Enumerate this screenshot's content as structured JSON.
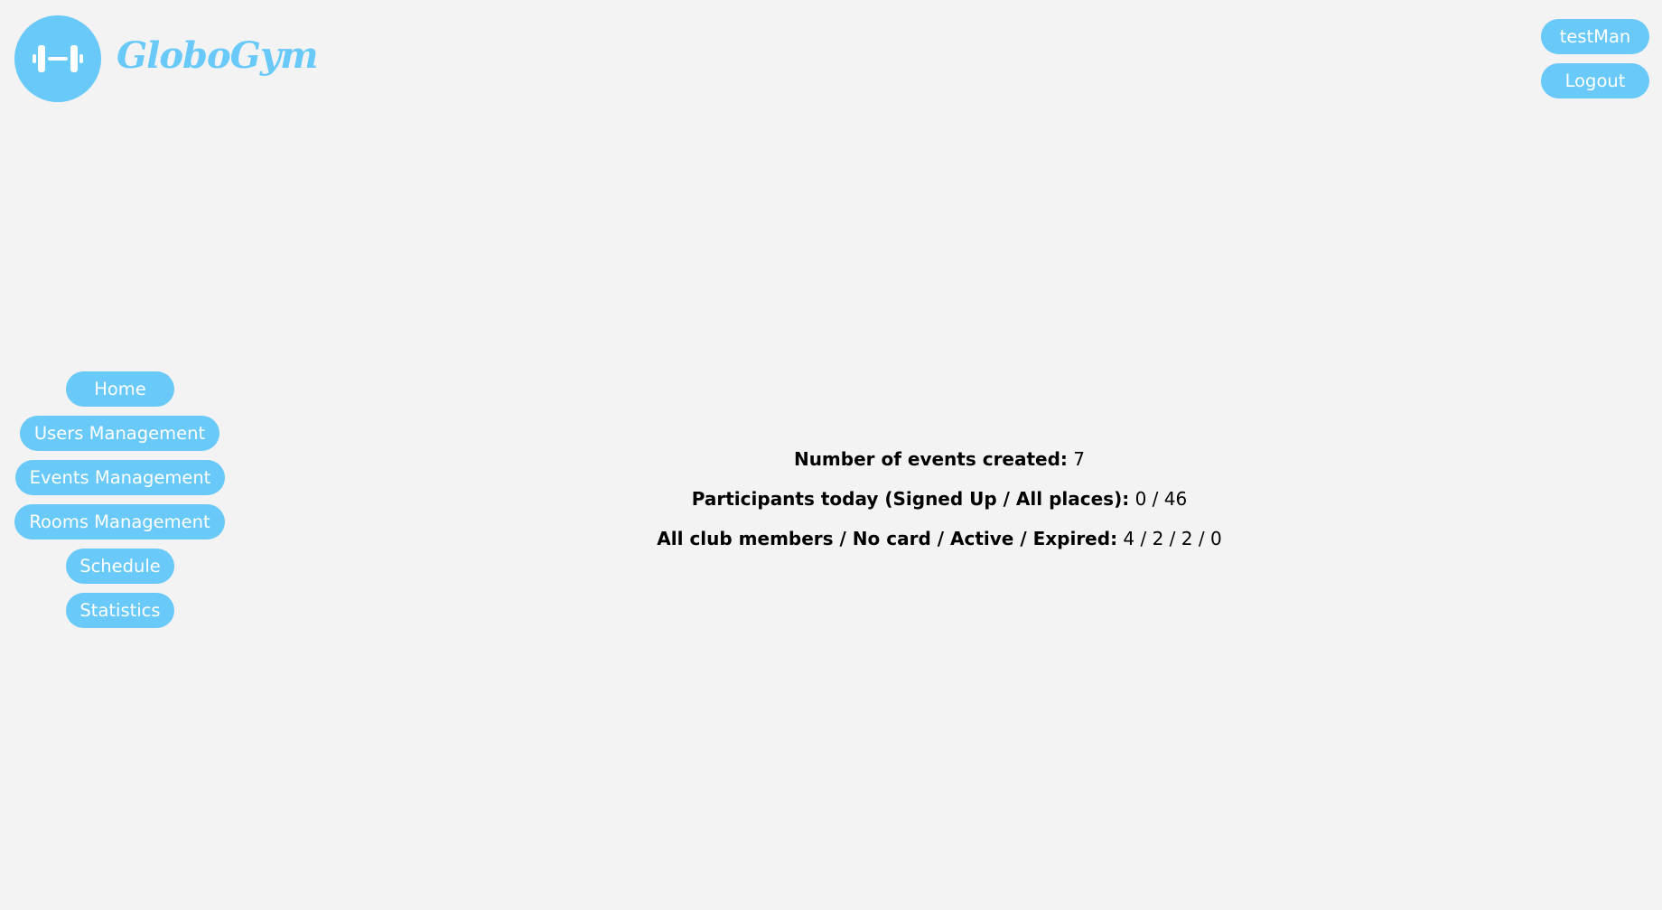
{
  "header": {
    "brand_name": "GloboGym",
    "logo_icon": "dumbbell-icon",
    "brand_color": "#69c9f8"
  },
  "user_menu": {
    "username": "testMan",
    "logout_label": "Logout"
  },
  "sidebar": {
    "items": [
      {
        "label": "Home"
      },
      {
        "label": "Users Management"
      },
      {
        "label": "Events Management"
      },
      {
        "label": "Rooms Management"
      },
      {
        "label": "Schedule"
      },
      {
        "label": "Statistics"
      }
    ]
  },
  "stats": [
    {
      "label": "Number of events created:",
      "value": "7"
    },
    {
      "label": "Participants today (Signed Up / All places):",
      "value": "0 / 46"
    },
    {
      "label": "All club members / No card / Active / Expired:",
      "value": "4 / 2 / 2 / 0"
    }
  ],
  "colors": {
    "accent": "#69c9f8",
    "background": "#f3f3f3",
    "button_text": "#ffffff"
  }
}
